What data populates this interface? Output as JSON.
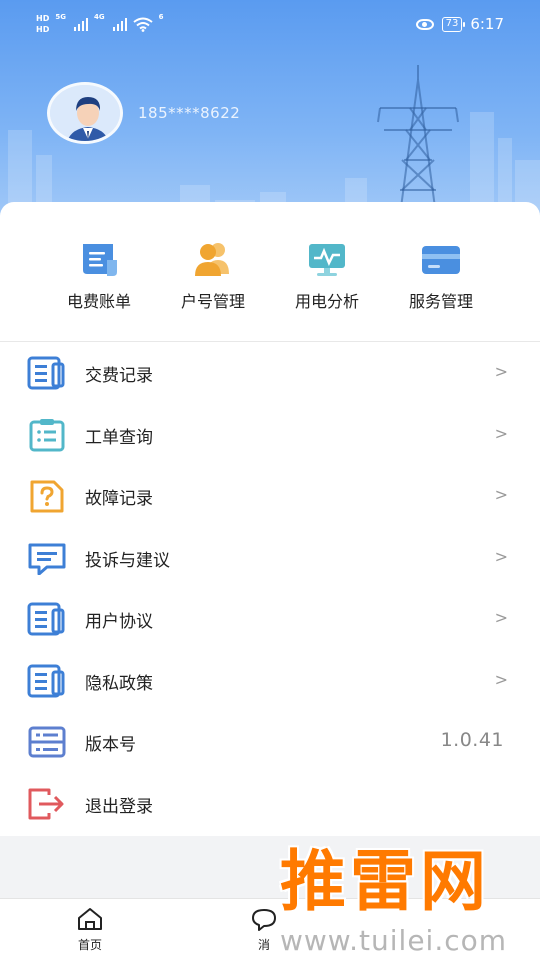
{
  "status_bar": {
    "hd_top": "HD",
    "hd_bottom": "HD",
    "net1": "5G",
    "net2": "4G",
    "wifi_tag": "6",
    "battery": "73",
    "time": "6:17"
  },
  "profile": {
    "phone": "185****8622"
  },
  "quick_actions": [
    {
      "label": "电费账单",
      "icon": "bill-icon"
    },
    {
      "label": "户号管理",
      "icon": "users-icon"
    },
    {
      "label": "用电分析",
      "icon": "monitor-chart-icon"
    },
    {
      "label": "服务管理",
      "icon": "card-icon"
    }
  ],
  "menu": [
    {
      "label": "交费记录",
      "icon": "document-list-icon",
      "chevron": ">"
    },
    {
      "label": "工单查询",
      "icon": "clipboard-list-icon",
      "chevron": ">"
    },
    {
      "label": "故障记录",
      "icon": "question-file-icon",
      "chevron": ">"
    },
    {
      "label": "投诉与建议",
      "icon": "message-icon",
      "chevron": ">"
    },
    {
      "label": "用户协议",
      "icon": "document-list-icon",
      "chevron": ">"
    },
    {
      "label": "隐私政策",
      "icon": "document-list-icon",
      "chevron": ">"
    },
    {
      "label": "版本号",
      "icon": "server-icon",
      "value": "1.0.41"
    },
    {
      "label": "退出登录",
      "icon": "logout-icon"
    }
  ],
  "tabbar": {
    "home": "首页",
    "messages": "消"
  },
  "watermark": {
    "brand": "推雷网",
    "url": "www.tuilei.com"
  },
  "colors": {
    "header_top": "#5a9bf0",
    "header_bottom": "#a9cdf8",
    "icon_blue": "#3d7fd6",
    "icon_teal": "#52b7c9",
    "icon_orange": "#f0a531",
    "icon_red": "#e0595d",
    "watermark_orange": "#ff7a00"
  }
}
